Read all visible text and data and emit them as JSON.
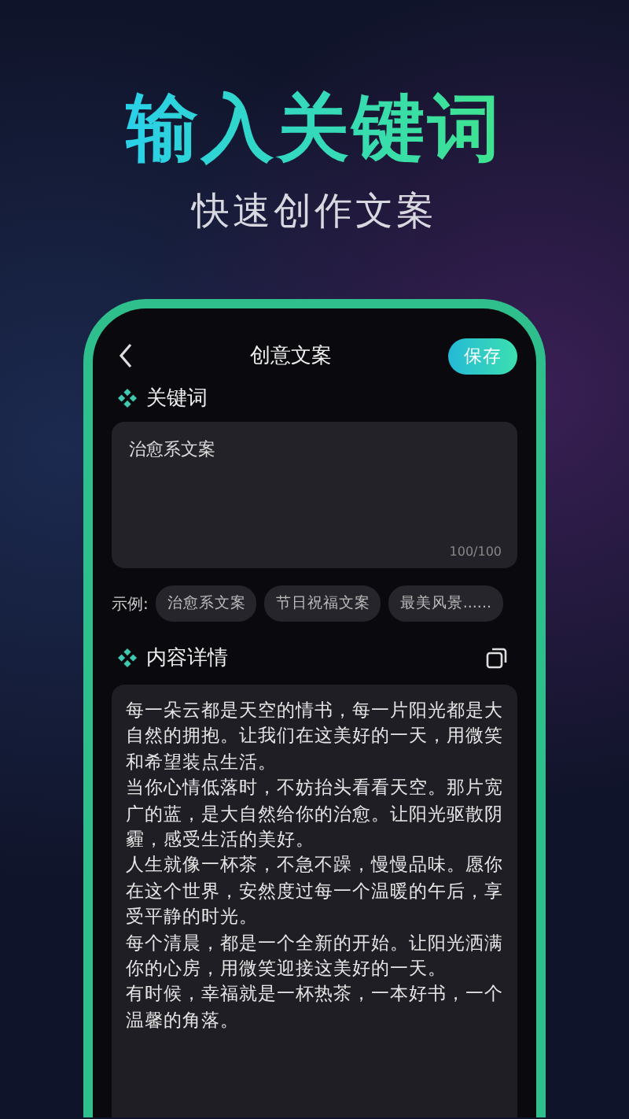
{
  "headline": "输入关键词",
  "subtitle": "快速创作文案",
  "screen": {
    "title": "创意文案",
    "save_button": "保存",
    "keyword_section": {
      "label": "关键词",
      "value": "治愈系文案",
      "counter": "100/100"
    },
    "examples": {
      "label": "示例:",
      "items": [
        "治愈系文案",
        "节日祝福文案",
        "最美风景......"
      ]
    },
    "content_section": {
      "label": "内容详情",
      "paragraphs": [
        "每一朵云都是天空的情书，每一片阳光都是大自然的拥抱。让我们在这美好的一天，用微笑和希望装点生活。",
        "当你心情低落时，不妨抬头看看天空。那片宽广的蓝，是大自然给你的治愈。让阳光驱散阴霾，感受生活的美好。",
        "人生就像一杯茶，不急不躁，慢慢品味。愿你在这个世界，安然度过每一个温暖的午后，享受平静的时光。",
        "每个清晨，都是一个全新的开始。让阳光洒满你的心房，用微笑迎接这美好的一天。",
        "有时候，幸福就是一杯热茶，一本好书，一个温馨的角落。"
      ]
    }
  }
}
